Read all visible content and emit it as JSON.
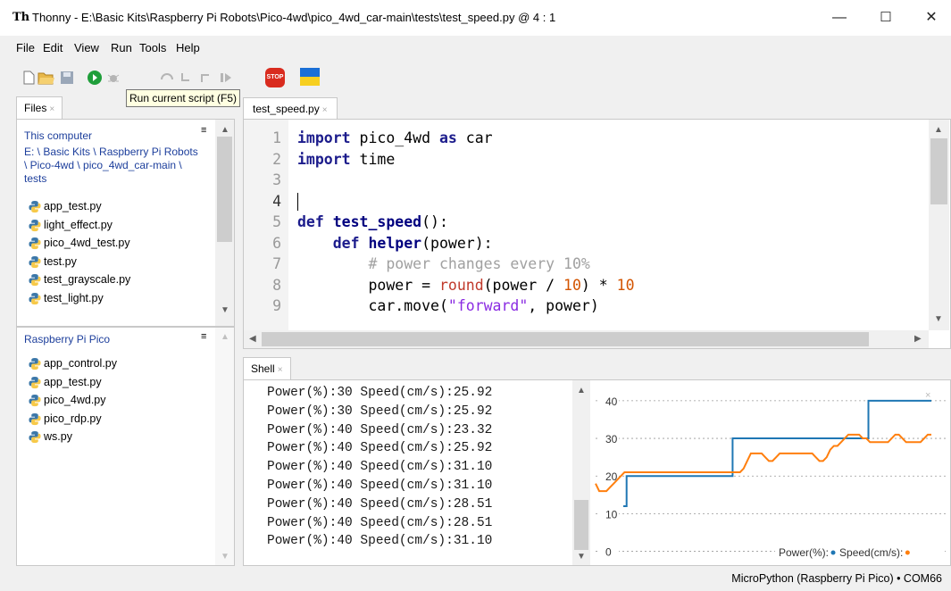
{
  "window": {
    "app_icon": "Th",
    "title": "Thonny  -  E:\\Basic Kits\\Raspberry Pi Robots\\Pico-4wd\\pico_4wd_car-main\\tests\\test_speed.py  @  4 : 1",
    "min": "—",
    "max": "☐",
    "close": "✕"
  },
  "menu": [
    "File",
    "Edit",
    "View",
    "Run",
    "Tools",
    "Help"
  ],
  "toolbar": {
    "icons": [
      "new-file-icon",
      "open-folder-icon",
      "save-icon",
      "run-icon",
      "debug-icon",
      "step-over-icon",
      "step-into-icon",
      "step-out-icon",
      "resume-icon",
      "stop-icon",
      "ukraine-flag-icon"
    ],
    "stop_label": "STOP"
  },
  "tooltip": "Run current script (F5)",
  "files_panel": {
    "tab": "Files",
    "tab_close": "×",
    "computer_title": "This computer",
    "path": "E: \\ Basic Kits \\ Raspberry Pi Robots \\ Pico-4wd \\ pico_4wd_car-main \\ tests",
    "computer_files": [
      "app_test.py",
      "light_effect.py",
      "pico_4wd_test.py",
      "test.py",
      "test_grayscale.py",
      "test_light.py"
    ],
    "pico_title": "Raspberry Pi Pico",
    "pico_files": [
      "app_control.py",
      "app_test.py",
      "pico_4wd.py",
      "pico_rdp.py",
      "ws.py"
    ],
    "menu_glyph": "≡"
  },
  "editor": {
    "tab": "test_speed.py",
    "tab_close": "×",
    "line_numbers": [
      "1",
      "2",
      "3",
      "4",
      "5",
      "6",
      "7",
      "8",
      "9"
    ],
    "code": [
      [
        {
          "t": "import",
          "c": "kw"
        },
        {
          "t": " pico_4wd "
        },
        {
          "t": "as",
          "c": "kw"
        },
        {
          "t": " car"
        }
      ],
      [
        {
          "t": "import",
          "c": "kw"
        },
        {
          "t": " time"
        }
      ],
      [],
      [
        {
          "t": "|",
          "c": "cursor"
        }
      ],
      [
        {
          "t": "def",
          "c": "kw"
        },
        {
          "t": " "
        },
        {
          "t": "test_speed",
          "c": "fn"
        },
        {
          "t": "():"
        }
      ],
      [
        {
          "t": "    "
        },
        {
          "t": "def",
          "c": "kw"
        },
        {
          "t": " "
        },
        {
          "t": "helper",
          "c": "fn"
        },
        {
          "t": "(power):"
        }
      ],
      [
        {
          "t": "        "
        },
        {
          "t": "# power changes every 10%",
          "c": "cm"
        }
      ],
      [
        {
          "t": "        power = "
        },
        {
          "t": "round",
          "c": "bi"
        },
        {
          "t": "(power / "
        },
        {
          "t": "10",
          "c": "num"
        },
        {
          "t": ") * "
        },
        {
          "t": "10",
          "c": "num"
        }
      ],
      [
        {
          "t": "        car.move("
        },
        {
          "t": "\"forward\"",
          "c": "str"
        },
        {
          "t": ", power)"
        }
      ]
    ]
  },
  "shell": {
    "tab": "Shell",
    "tab_close": "×",
    "lines": [
      "Power(%):30 Speed(cm/s):25.92",
      "Power(%):30 Speed(cm/s):25.92",
      "Power(%):40 Speed(cm/s):23.32",
      "Power(%):40 Speed(cm/s):25.92",
      "Power(%):40 Speed(cm/s):31.10",
      "Power(%):40 Speed(cm/s):31.10",
      "Power(%):40 Speed(cm/s):28.51",
      "Power(%):40 Speed(cm/s):28.51",
      "Power(%):40 Speed(cm/s):31.10"
    ]
  },
  "chart_data": {
    "type": "line",
    "ylim": [
      -2,
      44
    ],
    "yticks": [
      "40",
      "30",
      "20",
      "10",
      "0"
    ],
    "series": [
      {
        "name": "Power(%):",
        "color": "#1f77b4",
        "values": [
          12,
          20,
          20,
          20,
          20,
          20,
          20,
          20,
          20,
          20,
          20,
          20,
          20,
          20,
          20,
          20,
          20,
          20,
          20,
          20,
          20,
          20,
          20,
          20,
          20,
          20,
          20,
          20,
          20,
          20,
          20,
          20,
          20,
          30,
          30,
          30,
          30,
          30,
          30,
          30,
          30,
          30,
          30,
          30,
          30,
          30,
          30,
          30,
          30,
          30,
          30,
          30,
          30,
          30,
          30,
          30,
          30,
          30,
          30,
          30,
          30,
          30,
          30,
          30,
          30,
          30,
          30,
          30,
          30,
          30,
          30,
          30,
          30,
          30,
          40,
          40,
          40,
          40,
          40,
          40,
          40,
          40,
          40,
          40,
          40,
          40,
          40,
          40,
          40,
          40,
          40,
          40,
          40,
          40
        ]
      },
      {
        "name": "Speed(cm/s):",
        "color": "#ff7f0e",
        "values": [
          18,
          16,
          16,
          16,
          17,
          18,
          19,
          20,
          21,
          21,
          21,
          21,
          21,
          21,
          21,
          21,
          21,
          21,
          21,
          21,
          21,
          21,
          21,
          21,
          21,
          21,
          21,
          21,
          21,
          21,
          21,
          21,
          21,
          21,
          21,
          21,
          21,
          21,
          21,
          21,
          21,
          22,
          24,
          26,
          26,
          26,
          26,
          25,
          24,
          24,
          25,
          26,
          26,
          26,
          26,
          26,
          26,
          26,
          26,
          26,
          26,
          25,
          24,
          24,
          25,
          27,
          28,
          28,
          29,
          30,
          31,
          31,
          31,
          31,
          30,
          30,
          29,
          29,
          29,
          29,
          29,
          29,
          30,
          31,
          31,
          30,
          29,
          29,
          29,
          29,
          29,
          30,
          31,
          31
        ]
      }
    ],
    "legend": "bottom-right",
    "grid": "horizontal-dotted"
  },
  "status": "MicroPython (Raspberry Pi Pico)  •  COM66"
}
